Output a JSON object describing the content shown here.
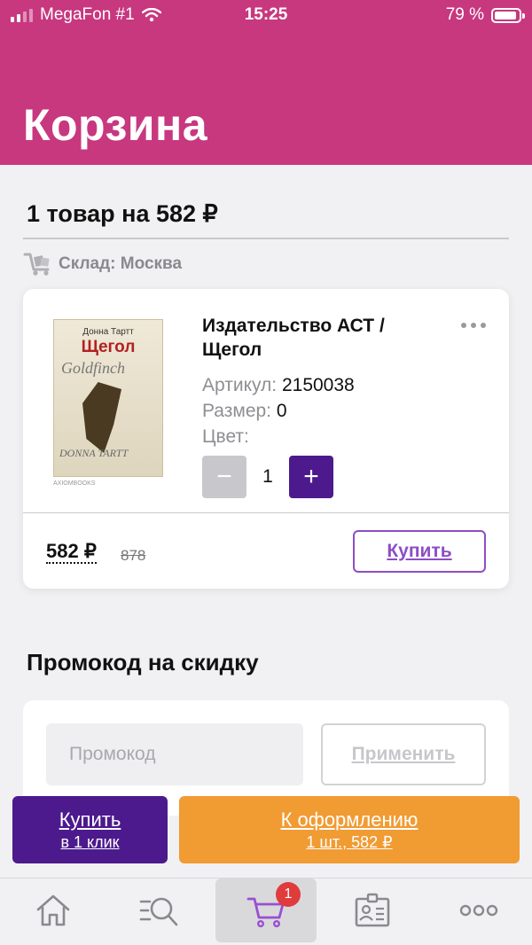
{
  "status_bar": {
    "carrier": "MegaFon #1",
    "time": "15:25",
    "battery": "79 %"
  },
  "header": {
    "title": "Корзина"
  },
  "cart": {
    "summary": "1 товар на 582 ₽",
    "warehouse": "Склад: Москва",
    "item": {
      "cover": {
        "author": "Донна Тартт",
        "title": "Щегол",
        "overlay": "Goldfinch",
        "bottom": "DONNA TARTT",
        "note": "AXIOMBOOKS"
      },
      "name": "Издательство АСТ / Щегол",
      "article_label": "Артикул:",
      "article_value": "2150038",
      "size_label": "Размер:",
      "size_value": "0",
      "color_label": "Цвет:",
      "color_value": "",
      "quantity": "1",
      "minus": "−",
      "plus": "+",
      "price": "582 ₽",
      "old_price": "878",
      "buy_label": "Купить"
    }
  },
  "promo": {
    "title": "Промокод на скидку",
    "placeholder": "Промокод",
    "apply_label": "Применить"
  },
  "actions": {
    "quick_buy_main": "Купить",
    "quick_buy_sub": "в 1 клик",
    "checkout_main": "К оформлению",
    "checkout_sub": "1 шт., 582 ₽"
  },
  "tabbar": {
    "items": [
      {
        "icon": "home-icon"
      },
      {
        "icon": "search-icon"
      },
      {
        "icon": "cart-icon",
        "badge": "1"
      },
      {
        "icon": "profile-card-icon"
      },
      {
        "icon": "more-icon"
      }
    ]
  },
  "colors": {
    "brand": "#c7387f",
    "accent": "#4c1a8c",
    "checkout": "#f19b33",
    "badge": "#e03c3c"
  }
}
